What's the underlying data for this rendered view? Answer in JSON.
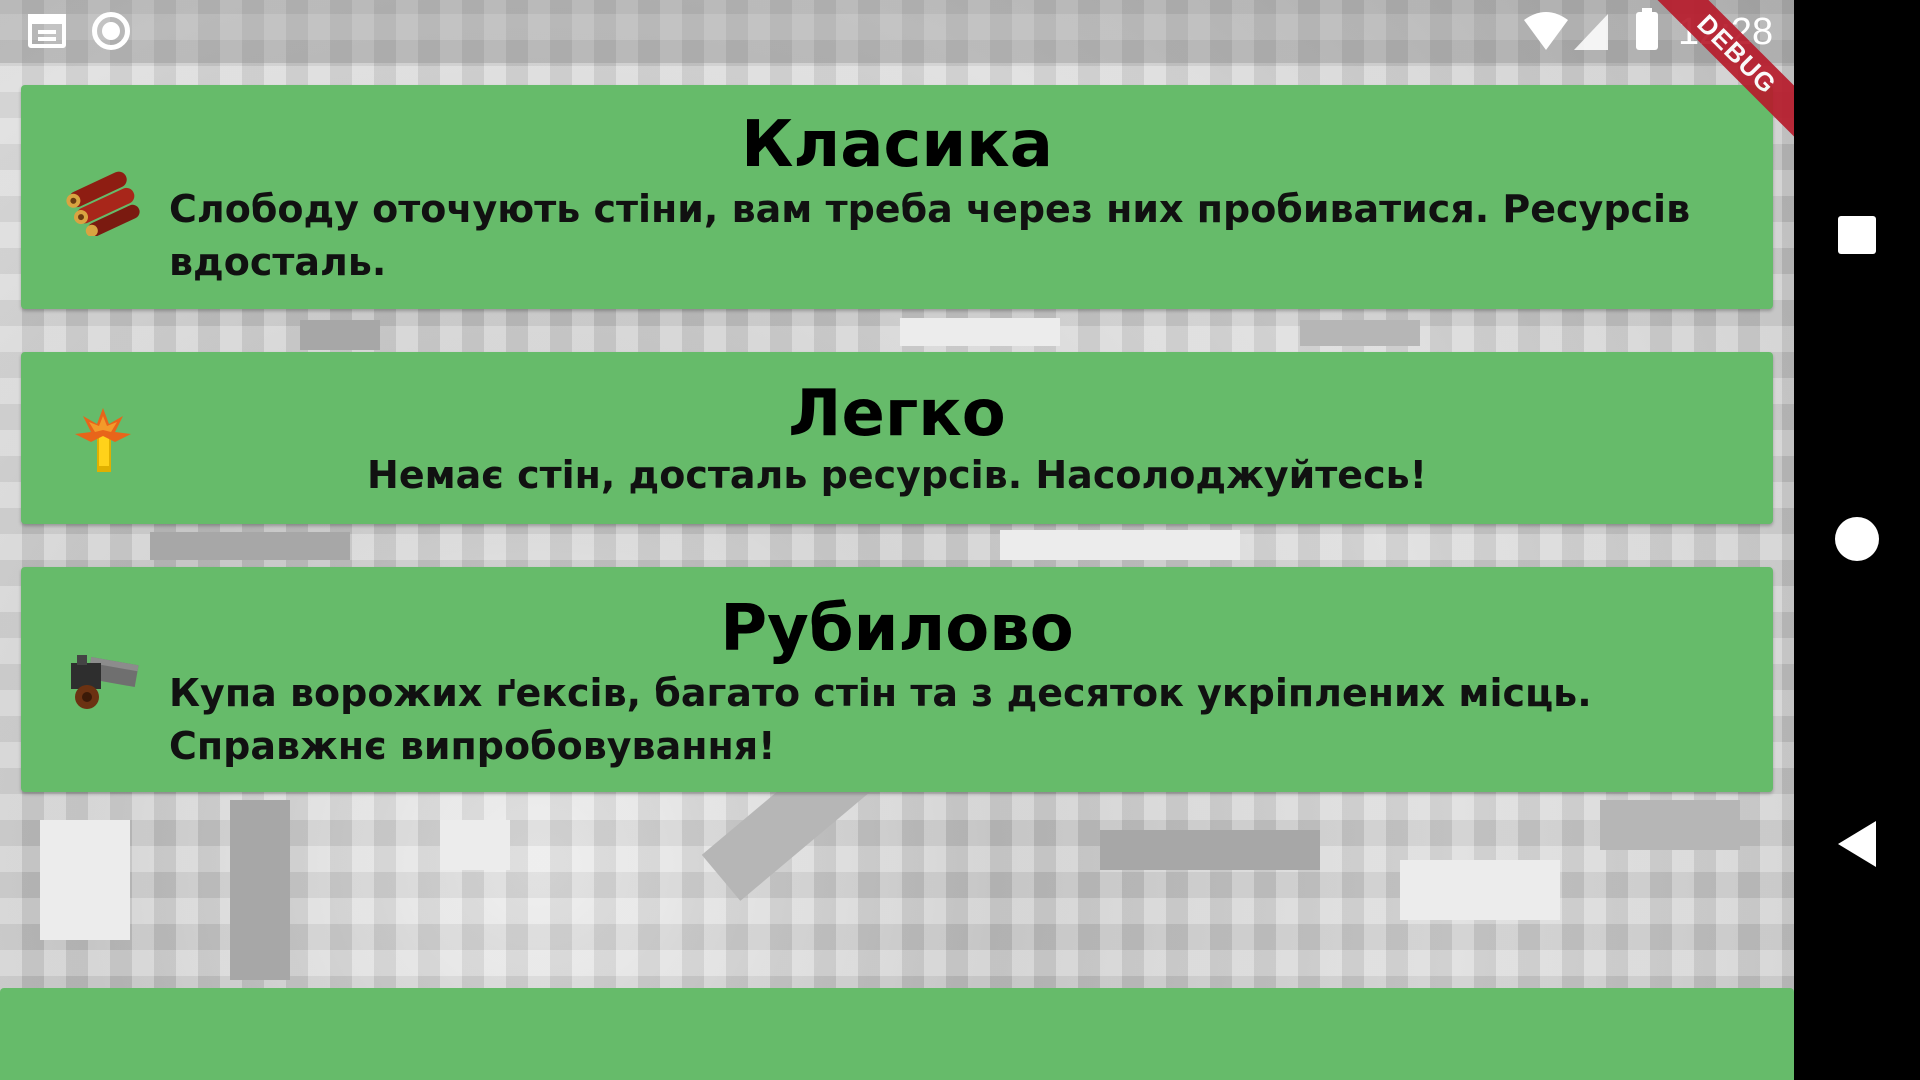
{
  "status_bar": {
    "time": "12:28",
    "icons": [
      "calendar-icon",
      "record-icon",
      "wifi-icon",
      "signal-icon",
      "battery-icon"
    ]
  },
  "debug_banner": "DEBUG",
  "modes": [
    {
      "title": "Класика",
      "description": "Слободу оточують стіни, вам треба через них пробиватися. Ресурсів вдосталь.",
      "icon": "logs-icon"
    },
    {
      "title": "Легко",
      "description": "Немає стін, досталь ресурсів. Насолоджуйтесь!",
      "icon": "wheat-icon"
    },
    {
      "title": "Рубилово",
      "description": "Купа ворожих ґексів, багато стін та з десяток укріплених місць. Справжнє випробовування!",
      "icon": "cannon-icon"
    }
  ],
  "colors": {
    "card": "#66bb6a",
    "debug": "#b71c2c",
    "nav": "#000000"
  },
  "nav_bar": {
    "buttons": [
      "recent-apps-icon",
      "home-icon",
      "back-icon"
    ]
  }
}
